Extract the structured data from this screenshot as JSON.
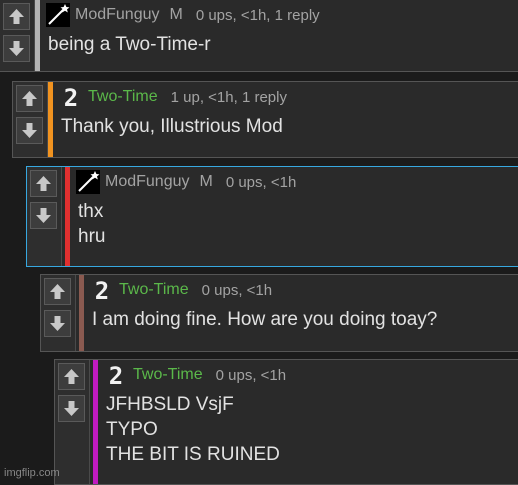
{
  "comments": [
    {
      "author": "ModFunguy",
      "badge": "M",
      "meta": "0 ups, <1h, 1 reply",
      "lines": [
        "being a Two-Time-r"
      ],
      "accent_color": "#b5b5b5",
      "author_color": "#a3a3a3",
      "avatar_icon": "shooting-star-icon"
    },
    {
      "author": "Two-Time",
      "meta": "1 up, <1h, 1 reply",
      "lines": [
        "Thank you, Illustrious Mod"
      ],
      "accent_color": "#f19320",
      "author_color": "#5bb84a",
      "avatar_icon": "number-two-icon"
    },
    {
      "author": "ModFunguy",
      "badge": "M",
      "meta": "0 ups, <1h",
      "lines": [
        "thx",
        "hru"
      ],
      "accent_color": "#e13030",
      "border_color": "#37a8e0",
      "author_color": "#a3a3a3",
      "avatar_icon": "shooting-star-icon"
    },
    {
      "author": "Two-Time",
      "meta": "0 ups, <1h",
      "lines": [
        "I am doing fine. How are you doing toay?"
      ],
      "accent_color": "#8a5a50",
      "author_color": "#5bb84a",
      "avatar_icon": "number-two-icon"
    },
    {
      "author": "Two-Time",
      "meta": "0 ups, <1h",
      "lines": [
        "JFHBSLD VsjF",
        "TYPO",
        "THE BIT IS RUINED"
      ],
      "accent_color": "#c21bc2",
      "author_color": "#5bb84a",
      "avatar_icon": "number-two-icon"
    }
  ],
  "watermark": "imgflip.com"
}
